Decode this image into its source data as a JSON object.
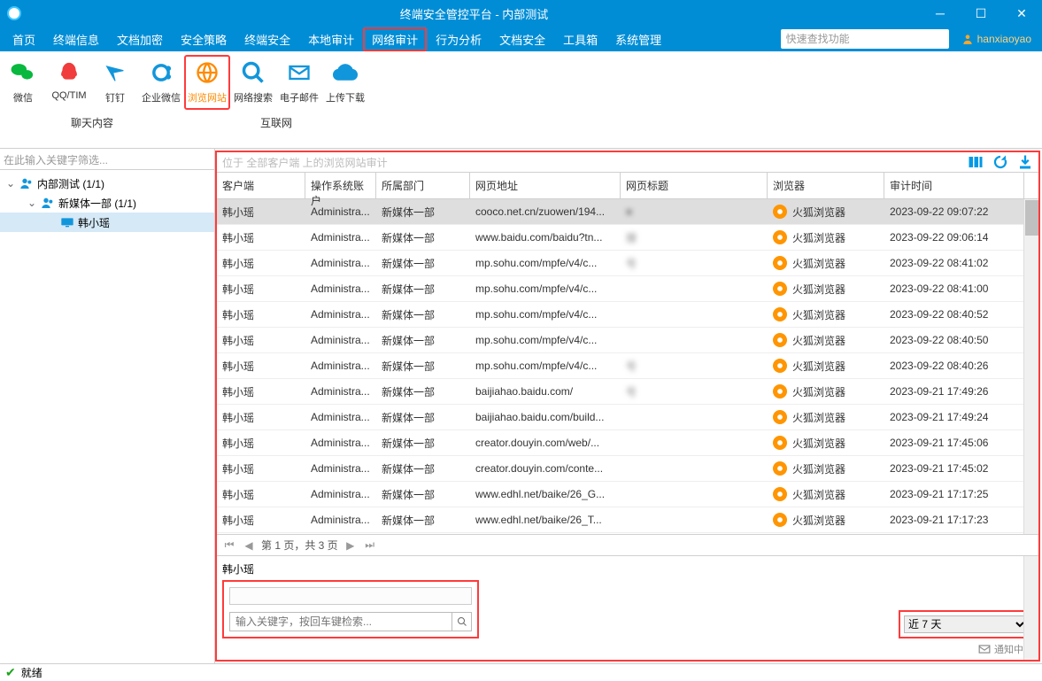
{
  "title": "终端安全管控平台 - 内部测试",
  "menu": [
    "首页",
    "终端信息",
    "文档加密",
    "安全策略",
    "终端安全",
    "本地审计",
    "网络审计",
    "行为分析",
    "文档安全",
    "工具箱",
    "系统管理"
  ],
  "menu_active_index": 6,
  "search_placeholder": "快速查找功能",
  "user": "hanxiaoyao",
  "ribbon": {
    "group1": {
      "label": "聊天内容",
      "items": [
        {
          "label": "微信",
          "color": "#09b83e"
        },
        {
          "label": "QQ/TIM",
          "color": "#f03c3c"
        },
        {
          "label": "钉钉",
          "color": "#1296db"
        },
        {
          "label": "企业微信",
          "color": "#1296db"
        }
      ]
    },
    "group2": {
      "label": "互联网",
      "items": [
        {
          "label": "浏览网站",
          "color": "#1296db",
          "active": true
        },
        {
          "label": "网络搜索",
          "color": "#1296db"
        },
        {
          "label": "电子邮件",
          "color": "#1296db"
        },
        {
          "label": "上传下载",
          "color": "#1296db"
        }
      ]
    }
  },
  "tree": {
    "filter_placeholder": "在此输入关键字筛选...",
    "root": "内部测试 (1/1)",
    "dept": "新媒体一部 (1/1)",
    "user": "韩小瑶"
  },
  "breadcrumb": "位于 全部客户端 上的浏览网站审计",
  "columns": [
    "客户端",
    "操作系统账户",
    "所属部门",
    "网页地址",
    "网页标题",
    "浏览器",
    "审计时间"
  ],
  "rows": [
    {
      "client": "韩小瑶",
      "acct": "Administra...",
      "dept": "新媒体一部",
      "url": "cooco.net.cn/zuowen/194...",
      "title": "■",
      "browser": "火狐浏览器",
      "time": "2023-09-22 09:07:22",
      "sel": true
    },
    {
      "client": "韩小瑶",
      "acct": "Administra...",
      "dept": "新媒体一部",
      "url": "www.baidu.com/baidu?tn...",
      "title": "搜",
      "browser": "火狐浏览器",
      "time": "2023-09-22 09:06:14"
    },
    {
      "client": "韩小瑶",
      "acct": "Administra...",
      "dept": "新媒体一部",
      "url": "mp.sohu.com/mpfe/v4/c...",
      "title": "号",
      "browser": "火狐浏览器",
      "time": "2023-09-22 08:41:02"
    },
    {
      "client": "韩小瑶",
      "acct": "Administra...",
      "dept": "新媒体一部",
      "url": "mp.sohu.com/mpfe/v4/c...",
      "title": "",
      "browser": "火狐浏览器",
      "time": "2023-09-22 08:41:00"
    },
    {
      "client": "韩小瑶",
      "acct": "Administra...",
      "dept": "新媒体一部",
      "url": "mp.sohu.com/mpfe/v4/c...",
      "title": "",
      "browser": "火狐浏览器",
      "time": "2023-09-22 08:40:52"
    },
    {
      "client": "韩小瑶",
      "acct": "Administra...",
      "dept": "新媒体一部",
      "url": "mp.sohu.com/mpfe/v4/c...",
      "title": "",
      "browser": "火狐浏览器",
      "time": "2023-09-22 08:40:50"
    },
    {
      "client": "韩小瑶",
      "acct": "Administra...",
      "dept": "新媒体一部",
      "url": "mp.sohu.com/mpfe/v4/c...",
      "title": "号",
      "browser": "火狐浏览器",
      "time": "2023-09-22 08:40:26"
    },
    {
      "client": "韩小瑶",
      "acct": "Administra...",
      "dept": "新媒体一部",
      "url": "baijiahao.baidu.com/",
      "title": "号",
      "browser": "火狐浏览器",
      "time": "2023-09-21 17:49:26"
    },
    {
      "client": "韩小瑶",
      "acct": "Administra...",
      "dept": "新媒体一部",
      "url": "baijiahao.baidu.com/build...",
      "title": "",
      "browser": "火狐浏览器",
      "time": "2023-09-21 17:49:24"
    },
    {
      "client": "韩小瑶",
      "acct": "Administra...",
      "dept": "新媒体一部",
      "url": "creator.douyin.com/web/...",
      "title": "",
      "browser": "火狐浏览器",
      "time": "2023-09-21 17:45:06"
    },
    {
      "client": "韩小瑶",
      "acct": "Administra...",
      "dept": "新媒体一部",
      "url": "creator.douyin.com/conte...",
      "title": "",
      "browser": "火狐浏览器",
      "time": "2023-09-21 17:45:02"
    },
    {
      "client": "韩小瑶",
      "acct": "Administra...",
      "dept": "新媒体一部",
      "url": "www.edhl.net/baike/26_G...",
      "title": "",
      "browser": "火狐浏览器",
      "time": "2023-09-21 17:17:25"
    },
    {
      "client": "韩小瑶",
      "acct": "Administra...",
      "dept": "新媒体一部",
      "url": "www.edhl.net/baike/26_T...",
      "title": "",
      "browser": "火狐浏览器",
      "time": "2023-09-21 17:17:23"
    }
  ],
  "pager": "第 1 页，共 3 页",
  "detail": {
    "name": "韩小瑶",
    "search_placeholder": "输入关键字，按回车键检索...",
    "date_range": "近 7 天",
    "notif": "通知中心"
  },
  "status": "就绪"
}
